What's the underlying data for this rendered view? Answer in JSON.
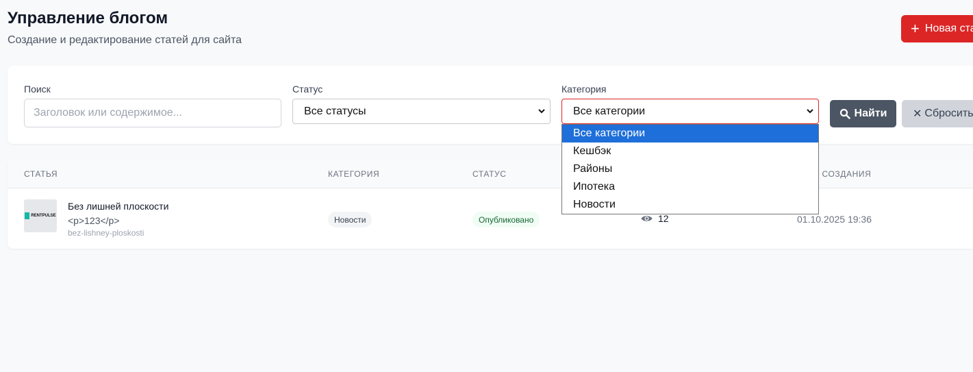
{
  "header": {
    "title": "Управление блогом",
    "subtitle": "Создание и редактирование статей для сайта",
    "new_button": "Новая статья"
  },
  "filters": {
    "search_label": "Поиск",
    "search_placeholder": "Заголовок или содержимое...",
    "status_label": "Статус",
    "status_value": "Все статусы",
    "category_label": "Категория",
    "category_value": "Все категории",
    "category_options": [
      "Все категории",
      "Кешбэк",
      "Районы",
      "Ипотека",
      "Новости"
    ],
    "find_button": "Найти",
    "reset_button": "Сбросить"
  },
  "table": {
    "headers": [
      "СТАТЬЯ",
      "КАТЕГОРИЯ",
      "СТАТУС",
      "ДАТА СОЗДАНИЯ"
    ],
    "rows": [
      {
        "thumb_text": "RENTPULSE",
        "title": "Без лишней плоскости",
        "excerpt": "<p>123</p>",
        "slug": "bez-lishney-ploskosti",
        "category": "Новости",
        "status": "Опубликовано",
        "views": "12",
        "created": "01.10.2025 19:36"
      }
    ]
  },
  "colors": {
    "accent_red": "#dc2626",
    "option_selected": "#1e6fd9",
    "status_green": "#166534"
  }
}
